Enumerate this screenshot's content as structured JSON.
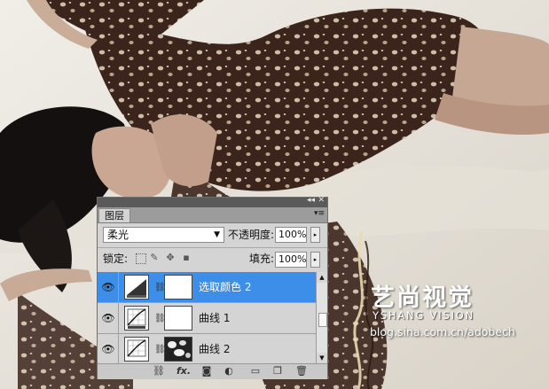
{
  "watermark": {
    "title": "艺尚视觉",
    "subtitle": "YSHANG VISION",
    "url": "blog.sina.com.cn/adobech"
  },
  "panel": {
    "collapse_icon": "double-arrow-icon",
    "close_icon": "close-icon",
    "tab_label": "图层",
    "blend_mode": "柔光",
    "opacity_label": "不透明度:",
    "opacity_value": "100%",
    "lock_label": "锁定:",
    "fill_label": "填充:",
    "fill_value": "100%",
    "layers": [
      {
        "name": "选取颜色 2",
        "type": "selective-color",
        "selected": true
      },
      {
        "name": "曲线 1",
        "type": "curves",
        "selected": false
      },
      {
        "name": "曲线 2",
        "type": "curves",
        "selected": false
      }
    ],
    "bottom_icons": [
      "link-icon",
      "fx-icon",
      "mask-icon",
      "adjustment-icon",
      "group-folder-icon",
      "new-layer-icon",
      "trash-icon"
    ],
    "fx_label": "fx."
  },
  "colors": {
    "selection": "#3d8ee8",
    "panel_bg": "#d4d4d4"
  }
}
